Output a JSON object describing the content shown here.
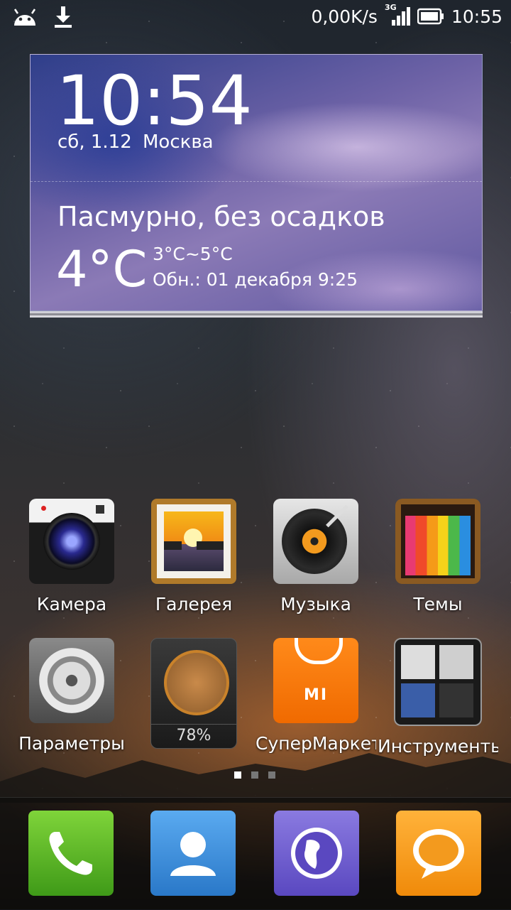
{
  "status_bar": {
    "net_speed": "0,00K/s",
    "network_type": "3G",
    "time": "10:55",
    "icons": [
      "android-icon",
      "download-icon",
      "signal-icon",
      "battery-icon"
    ]
  },
  "weather_widget": {
    "time": "10:54",
    "date": "сб, 1.12",
    "city": "Москва",
    "condition": "Пасмурно, без осадков",
    "temperature": "4°C",
    "range": "3°C~5°C",
    "updated": "Обн.:  01 декабря 9:25"
  },
  "apps": [
    {
      "label": "Камера",
      "icon": "camera-icon"
    },
    {
      "label": "Галерея",
      "icon": "gallery-icon"
    },
    {
      "label": "Музыка",
      "icon": "music-icon"
    },
    {
      "label": "Темы",
      "icon": "themes-icon"
    },
    {
      "label": "Параметры",
      "icon": "settings-icon"
    },
    {
      "label": "78%",
      "icon": "cleaner-icon"
    },
    {
      "label": "СуперМаркет",
      "icon": "market-icon"
    },
    {
      "label": "Инструменты",
      "icon": "tools-icon"
    }
  ],
  "pager": {
    "pages": 3,
    "current": 0
  },
  "dock": [
    {
      "icon": "phone-icon",
      "color": "#5cb82a"
    },
    {
      "icon": "contacts-icon",
      "color": "#3a8fd8"
    },
    {
      "icon": "browser-icon",
      "color": "#6e5fcf"
    },
    {
      "icon": "messages-icon",
      "color": "#f19a1a"
    }
  ]
}
